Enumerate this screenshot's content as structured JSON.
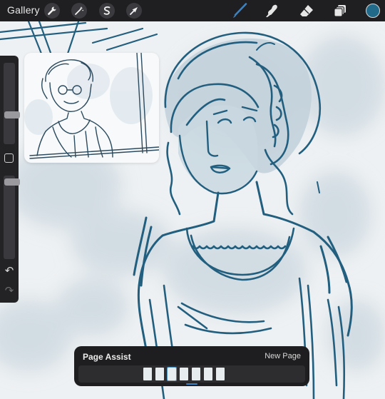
{
  "topbar": {
    "gallery_label": "Gallery",
    "left_tools": [
      "wrench-icon",
      "magic-wand-icon",
      "selection-icon",
      "transform-arrow-icon"
    ],
    "right_tools": [
      "brush-icon",
      "smudge-icon",
      "eraser-icon",
      "layers-icon"
    ],
    "current_color": "#226a8a"
  },
  "sidebar": {
    "controls": [
      "brush-size-slider",
      "modify-button",
      "brush-opacity-slider",
      "undo-icon",
      "redo-icon"
    ]
  },
  "page_assist": {
    "title": "Page Assist",
    "new_page_label": "New Page",
    "page_count": 7,
    "current_page": 3
  },
  "colors": {
    "ink": "#225e7e",
    "toolbar": "#1f1f22",
    "accent": "#3b82c4"
  }
}
